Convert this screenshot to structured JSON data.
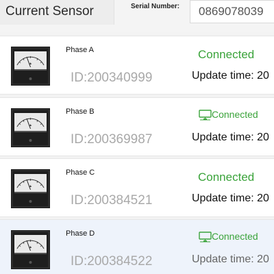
{
  "header": {
    "title": "Current Sensor",
    "serial_label": "Serial Number:",
    "serial_value": "0869078039"
  },
  "sensors": [
    {
      "phase": "Phase A",
      "id": "ID:200340999",
      "status": "Connected",
      "update": "Update time: 20"
    },
    {
      "phase": "Phase B",
      "id": "ID:200369987",
      "status": "Connected",
      "update": "Update time: 20"
    },
    {
      "phase": "Phase C",
      "id": "ID:200384521",
      "status": "Connected",
      "update": "Update time: 20"
    },
    {
      "phase": "Phase D",
      "id": "ID:200384522",
      "status": "Connected",
      "update": "Update time: 20"
    }
  ],
  "icons": {
    "meter": "analog-ammeter-icon",
    "connection": "monitor-connected-icon"
  },
  "colors": {
    "status_green": "#3aa33a",
    "id_gray": "#a9a9a9",
    "selected_row": "#eef3fb"
  }
}
